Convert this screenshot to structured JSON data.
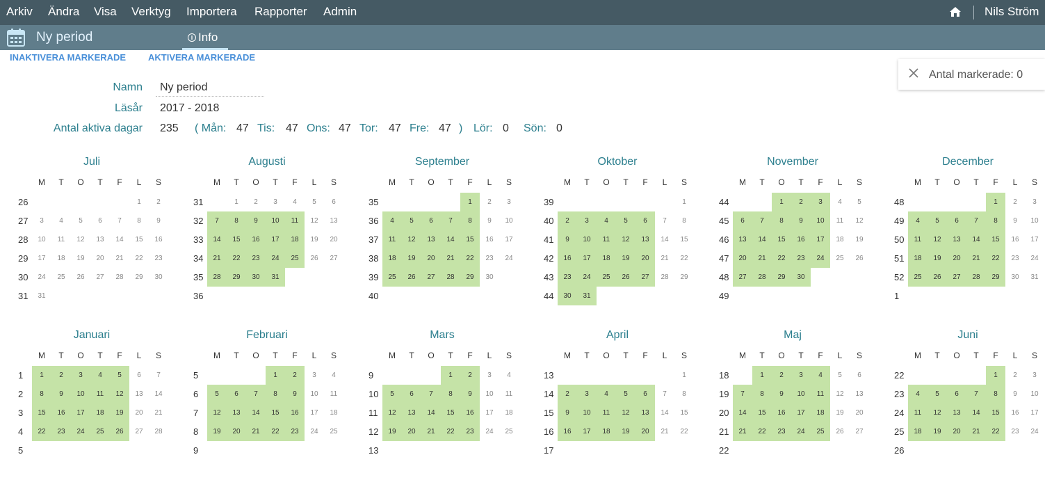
{
  "menu": [
    "Arkiv",
    "Ändra",
    "Visa",
    "Verktyg",
    "Importera",
    "Rapporter",
    "Admin"
  ],
  "user": {
    "name": "Nils Ström"
  },
  "period": {
    "title": "Ny period"
  },
  "tabs": {
    "info": "Info"
  },
  "actions": {
    "deactivate": "INAKTIVERA MARKERADE",
    "activate": "AKTIVERA MARKERADE"
  },
  "selection": {
    "label": "Antal markerade: 0"
  },
  "form": {
    "name_label": "Namn",
    "name_value": "Ny period",
    "year_label": "Läsår",
    "year_value": "2017 - 2018",
    "active_label": "Antal aktiva dagar",
    "active_value": "235",
    "days": [
      {
        "label": "( Mån:",
        "value": "47"
      },
      {
        "label": "Tis:",
        "value": "47"
      },
      {
        "label": "Ons:",
        "value": "47"
      },
      {
        "label": "Tor:",
        "value": "47"
      },
      {
        "label": "Fre:",
        "value": "47"
      },
      {
        "label": ")",
        "value": ""
      },
      {
        "label": "Lör:",
        "value": "0"
      },
      {
        "label": "Sön:",
        "value": "0"
      }
    ]
  },
  "weekday_headers": [
    "M",
    "T",
    "O",
    "T",
    "F",
    "L",
    "S"
  ],
  "colors": {
    "menubar": "#455a64",
    "subbar": "#607d8b",
    "active_day": "#c5e3a7",
    "accent": "#2c7f8e",
    "link": "#4a90d9"
  },
  "months": [
    {
      "name": "Juli",
      "weeks": [
        26,
        27,
        28,
        29,
        30,
        31
      ],
      "first_day": 5,
      "days": 31,
      "active": []
    },
    {
      "name": "Augusti",
      "weeks": [
        31,
        32,
        33,
        34,
        35,
        36
      ],
      "first_day": 1,
      "days": 31,
      "active": [
        7,
        8,
        9,
        10,
        11,
        14,
        15,
        16,
        17,
        18,
        21,
        22,
        23,
        24,
        25,
        28,
        29,
        30,
        31
      ]
    },
    {
      "name": "September",
      "weeks": [
        35,
        36,
        37,
        38,
        39,
        40
      ],
      "first_day": 4,
      "days": 30,
      "active": [
        1,
        4,
        5,
        6,
        7,
        8,
        11,
        12,
        13,
        14,
        15,
        18,
        19,
        20,
        21,
        22,
        25,
        26,
        27,
        28,
        29
      ]
    },
    {
      "name": "Oktober",
      "weeks": [
        39,
        40,
        41,
        42,
        43,
        44
      ],
      "first_day": 6,
      "days": 31,
      "active": [
        2,
        3,
        4,
        5,
        6,
        9,
        10,
        11,
        12,
        13,
        16,
        17,
        18,
        19,
        20,
        23,
        24,
        25,
        26,
        27,
        30,
        31
      ]
    },
    {
      "name": "November",
      "weeks": [
        44,
        45,
        46,
        47,
        48,
        49
      ],
      "first_day": 2,
      "days": 30,
      "active": [
        1,
        2,
        3,
        6,
        7,
        8,
        9,
        10,
        13,
        14,
        15,
        16,
        17,
        20,
        21,
        22,
        23,
        24,
        27,
        28,
        29,
        30
      ]
    },
    {
      "name": "December",
      "weeks": [
        48,
        49,
        50,
        51,
        52,
        1
      ],
      "first_day": 4,
      "days": 31,
      "active": [
        1,
        4,
        5,
        6,
        7,
        8,
        11,
        12,
        13,
        14,
        15,
        18,
        19,
        20,
        21,
        22,
        25,
        26,
        27,
        28,
        29
      ]
    },
    {
      "name": "Januari",
      "weeks": [
        1,
        2,
        3,
        4,
        5
      ],
      "first_day": 0,
      "days": 28,
      "active": [
        1,
        2,
        3,
        4,
        5,
        8,
        9,
        10,
        11,
        12,
        15,
        16,
        17,
        18,
        19,
        22,
        23,
        24,
        25,
        26
      ]
    },
    {
      "name": "Februari",
      "weeks": [
        5,
        6,
        7,
        8,
        9
      ],
      "first_day": 3,
      "days": 25,
      "active": [
        1,
        2,
        5,
        6,
        7,
        8,
        9,
        12,
        13,
        14,
        15,
        16,
        19,
        20,
        21,
        22,
        23
      ]
    },
    {
      "name": "Mars",
      "weeks": [
        9,
        10,
        11,
        12,
        13
      ],
      "first_day": 3,
      "days": 25,
      "active": [
        1,
        2,
        5,
        6,
        7,
        8,
        9,
        12,
        13,
        14,
        15,
        16,
        19,
        20,
        21,
        22,
        23
      ]
    },
    {
      "name": "April",
      "weeks": [
        13,
        14,
        15,
        16,
        17
      ],
      "first_day": 6,
      "days": 22,
      "active": [
        2,
        3,
        4,
        5,
        6,
        9,
        10,
        11,
        12,
        13,
        16,
        17,
        18,
        19,
        20
      ]
    },
    {
      "name": "Maj",
      "weeks": [
        18,
        19,
        20,
        21,
        22
      ],
      "first_day": 1,
      "days": 27,
      "active": [
        1,
        2,
        3,
        4,
        7,
        8,
        9,
        10,
        11,
        14,
        15,
        16,
        17,
        18,
        21,
        22,
        23,
        24,
        25
      ]
    },
    {
      "name": "Juni",
      "weeks": [
        22,
        23,
        24,
        25,
        26
      ],
      "first_day": 4,
      "days": 24,
      "active": [
        1,
        4,
        5,
        6,
        7,
        8,
        11,
        12,
        13,
        14,
        15,
        18,
        19,
        20,
        21,
        22
      ]
    }
  ]
}
